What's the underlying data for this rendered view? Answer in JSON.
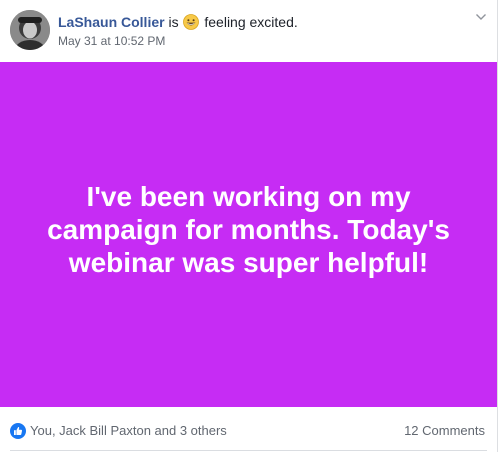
{
  "post": {
    "author": "LaShaun Collier",
    "feeling_prefix": "is",
    "feeling": "feeling excited.",
    "feeling_icon": "grinning-emoji-icon",
    "timestamp": "May 31 at 10:52 PM",
    "text": "I've been working on my campaign for months. Today's webinar was super helpful!",
    "background_color": "#c62cf4",
    "text_color": "#ffffff"
  },
  "footer": {
    "reactors": "You, Jack Bill Paxton and 3 others",
    "comments": "12 Comments",
    "reaction_icon": "like-reaction-icon"
  },
  "colors": {
    "author_link": "#385898",
    "secondary_text": "#616770",
    "like_blue": "#1877f2"
  }
}
